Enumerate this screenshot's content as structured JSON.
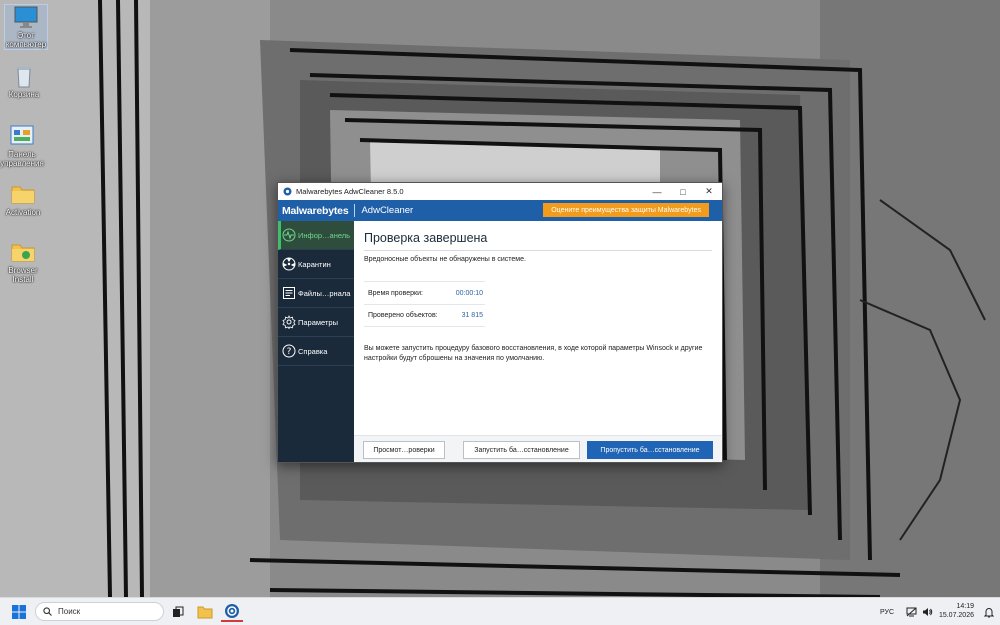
{
  "desktop": {
    "icons": [
      {
        "label": "Этот компьютер",
        "icon": "monitor-icon"
      },
      {
        "label": "Корзина",
        "icon": "recycle-bin-icon"
      },
      {
        "label": "Панель управления",
        "icon": "control-panel-icon"
      },
      {
        "label": "Activation",
        "icon": "folder-icon"
      },
      {
        "label": "Browser Install",
        "icon": "folder-icon"
      }
    ]
  },
  "window": {
    "title": "Malwarebytes AdwCleaner 8.5.0",
    "brand_main": "Malwarebytes",
    "brand_product": "AdwCleaner",
    "promo_label": "Оцените преимущества защиты Malwarebytes",
    "nav": [
      {
        "label": "Инфор…анель",
        "icon": "dashboard-pulse-icon",
        "active": true
      },
      {
        "label": "Карантин",
        "icon": "radiation-icon",
        "active": false
      },
      {
        "label": "Файлы…рнала",
        "icon": "log-file-icon",
        "active": false
      },
      {
        "label": "Параметры",
        "icon": "gear-icon",
        "active": false
      },
      {
        "label": "Справка",
        "icon": "help-icon",
        "active": false
      }
    ],
    "main": {
      "heading": "Проверка завершена",
      "message": "Вредоносные объекты не обнаружены в системе.",
      "stats": [
        {
          "label": "Время проверки:",
          "value": "00:00:10"
        },
        {
          "label": "Проверено объектов:",
          "value": "31 815"
        }
      ],
      "info": "Вы можете запустить процедуру базового восстановления, в ходе которой параметры Winsock и другие настройки будут сброшены на значения по умолчанию."
    },
    "buttons": {
      "view_report": "Просмот…роверки",
      "run_restore": "Запустить ба…сстановление",
      "skip_restore": "Пропустить ба…сстановление"
    }
  },
  "taskbar": {
    "search_placeholder": "Поиск",
    "language": "РУС",
    "time": "14:19",
    "date": "15.07.2026"
  },
  "colors": {
    "brand_blue": "#1f5fa8",
    "promo_orange": "#f39c1c",
    "sidebar_bg": "#1b2a3b",
    "active_green": "#3fbf6a",
    "primary_button": "#1f64b5"
  }
}
